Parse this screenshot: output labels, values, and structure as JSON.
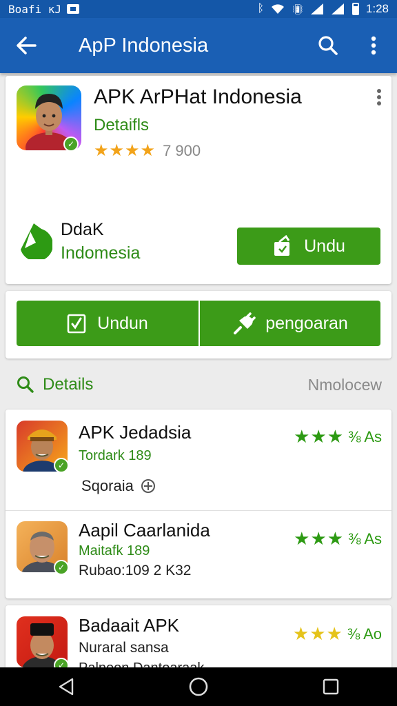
{
  "statusbar": {
    "carrier": "Boafi ĸJ",
    "time": "1:28"
  },
  "appbar": {
    "title": "ApP Indonesia"
  },
  "featured": {
    "app_name": "APK ArPHat Indonesia",
    "details_link": "Detaifls",
    "stars": "★★★★",
    "rating_count": "7 900",
    "developer_line1": "DdaK",
    "developer_line2": "Indomesia",
    "install_label": "Undu"
  },
  "actions": {
    "download_label": "Undun",
    "manage_label": "pengoaran"
  },
  "section": {
    "title": "Details",
    "link": "Nmolocew"
  },
  "list": [
    {
      "name": "APK Jedadsia",
      "sub1": "Tordark 189",
      "sub2": "Sqoraia",
      "stars": "★★★",
      "suffix": "⅜ As"
    },
    {
      "name": "Aapil Caarlanida",
      "sub1": "Maitafk 189",
      "sub2": "Rubao:109 2 K32",
      "stars": "★★★",
      "suffix": "⅜ As"
    },
    {
      "name": "Badaait APK",
      "sub1": "Nuraral sansa",
      "sub2": "Palnoon Dantoaraak",
      "stars": "★★★",
      "suffix": "⅜ Ao"
    }
  ],
  "colors": {
    "primary": "#1a5fb4",
    "accent_green": "#3c9b18",
    "star_orange": "#f2a31a",
    "star_green": "#2d9a13"
  }
}
